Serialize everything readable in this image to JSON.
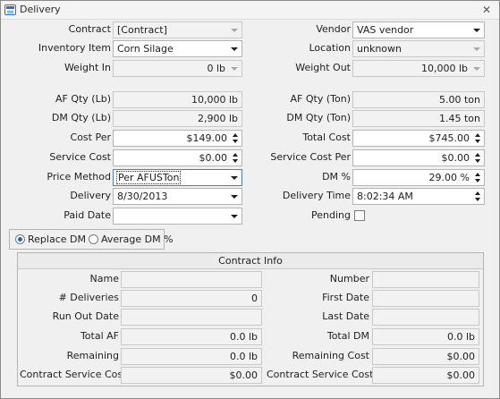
{
  "window": {
    "title": "Delivery",
    "icon": "form-icon",
    "close_glyph": "✕"
  },
  "form": {
    "contract": {
      "label": "Contract",
      "value": "[Contract]"
    },
    "vendor": {
      "label": "Vendor",
      "value": "VAS vendor"
    },
    "inventory_item": {
      "label": "Inventory Item",
      "value": "Corn Silage"
    },
    "location": {
      "label": "Location",
      "value": "unknown"
    },
    "weight_in": {
      "label": "Weight In",
      "value": "0 lb"
    },
    "weight_out": {
      "label": "Weight Out",
      "value": "10,000 lb"
    },
    "af_qty_lb": {
      "label": "AF Qty (Lb)",
      "value": "10,000 lb"
    },
    "af_qty_ton": {
      "label": "AF Qty (Ton)",
      "value": "5.00 ton"
    },
    "dm_qty_lb": {
      "label": "DM Qty (Lb)",
      "value": "2,900 lb"
    },
    "dm_qty_ton": {
      "label": "DM Qty (Ton)",
      "value": "1.45 ton"
    },
    "cost_per": {
      "label": "Cost Per",
      "value": "$149.00"
    },
    "total_cost": {
      "label": "Total Cost",
      "value": "$745.00"
    },
    "service_cost": {
      "label": "Service Cost",
      "value": "$0.00"
    },
    "service_cost_per": {
      "label": "Service Cost Per",
      "value": "$0.00"
    },
    "price_method": {
      "label": "Price Method",
      "value": "Per AFUSTon"
    },
    "dm_pct": {
      "label": "DM %",
      "value": "29.00 %"
    },
    "delivery": {
      "label": "Delivery",
      "value": "8/30/2013"
    },
    "delivery_time": {
      "label": "Delivery Time",
      "value": "8:02:34 AM"
    },
    "paid_date": {
      "label": "Paid Date",
      "value": ""
    },
    "pending": {
      "label": "Pending",
      "checked": false
    }
  },
  "dm_mode": {
    "options": [
      "Replace DM %",
      "Average DM %"
    ],
    "selected": "Replace DM %"
  },
  "contract_info": {
    "title": "Contract Info",
    "name": {
      "label": "Name",
      "value": ""
    },
    "number": {
      "label": "Number",
      "value": ""
    },
    "deliveries": {
      "label": "# Deliveries",
      "value": "0"
    },
    "first_date": {
      "label": "First Date",
      "value": ""
    },
    "run_out_date": {
      "label": "Run Out Date",
      "value": ""
    },
    "last_date": {
      "label": "Last Date",
      "value": ""
    },
    "total_af": {
      "label": "Total AF",
      "value": "0.0 lb"
    },
    "total_dm": {
      "label": "Total DM",
      "value": "0.0 lb"
    },
    "remaining": {
      "label": "Remaining",
      "value": "0.0 lb"
    },
    "remaining_cost": {
      "label": "Remaining Cost",
      "value": "$0.00"
    },
    "contract_service_cost": {
      "label": "Contract Service Cost",
      "value": "$0.00"
    },
    "contract_service_cost_per": {
      "label": "Contract Service Cost Per",
      "value": "$0.00"
    }
  }
}
